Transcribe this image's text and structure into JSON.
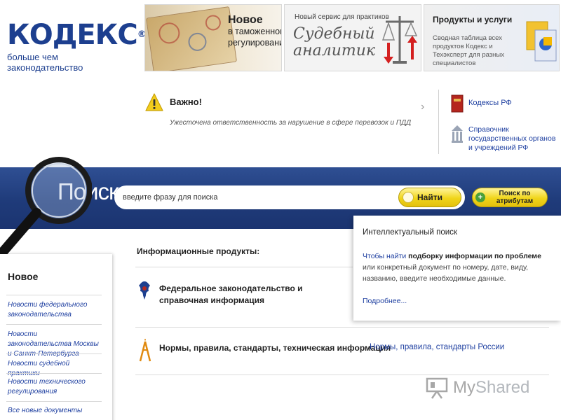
{
  "logo": {
    "word": "КОДЕКС",
    "registered": "®",
    "tagline": "больше чем законодательство"
  },
  "banners": [
    {
      "title_line1": "Новое",
      "title_line2": "в таможенном",
      "title_line3": "регулировании"
    },
    {
      "subtitle": "Новый сервис для практиков",
      "title_line1": "Судебный",
      "title_line2": "аналитик"
    },
    {
      "title": "Продукты и услуги",
      "text": "Сводная таблица всех продуктов Кодекс и Техэксперт для разных специалистов"
    }
  ],
  "important": {
    "title": "Важно!",
    "text": "Ужесточена ответственность за нарушение в сфере перевозок и ПДД",
    "arrow": "›"
  },
  "right_links": {
    "codes": "Кодексы РФ",
    "gov": "Справочник государственных органов и учреждений РФ"
  },
  "search": {
    "label": "Поиск",
    "placeholder": "введите фразу для поиска",
    "find_button": "Найти",
    "attr_button": "Поиск по атрибутам"
  },
  "sidebar": {
    "title": "Новое",
    "items": [
      {
        "label": "Новости федерального законодательства"
      },
      {
        "label": "Новости законодательства Москвы и Санкт-Петербурга"
      },
      {
        "label": "Новости судебной практики"
      },
      {
        "label": "Новости технического регулирования"
      },
      {
        "label": "Все новые документы"
      }
    ]
  },
  "products": {
    "title": "Информационные продукты:",
    "items": [
      {
        "label": "Федеральное законодательство и справочная информация"
      },
      {
        "label": "Нормы, правила, стандарты, техническая информация",
        "link": "Нормы, правила, стандарты России"
      }
    ]
  },
  "popup": {
    "title": "Интеллектуальный поиск",
    "text_part1": "Чтобы найти ",
    "text_bold": "подборку информации по проблеме",
    "text_part2": " или конкретный документ по номеру, дате, виду, названию, введите необходимые данные.",
    "more": "Подробнее..."
  },
  "watermark": {
    "text_my": "My",
    "text_shared": "Shared"
  },
  "colors": {
    "brand_blue": "#1d3f8f",
    "link_blue": "#1e3fa0",
    "band_blue": "#1f3b7a",
    "button_yellow": "#f0d51a"
  }
}
